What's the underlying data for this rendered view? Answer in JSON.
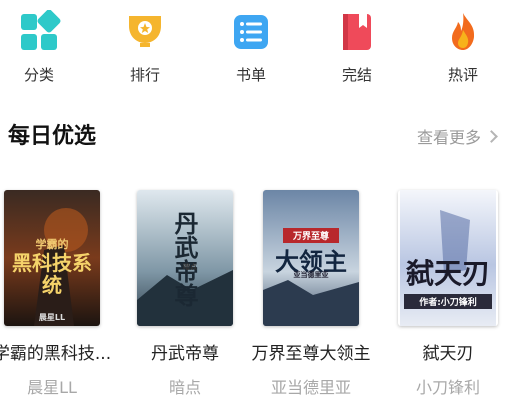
{
  "nav": [
    {
      "label": "分类",
      "icon": "grid-icon",
      "color": "#2ec9c9"
    },
    {
      "label": "排行",
      "icon": "trophy-icon",
      "color": "#f5b52e"
    },
    {
      "label": "书单",
      "icon": "list-icon",
      "color": "#3ea6f2"
    },
    {
      "label": "完结",
      "icon": "book-icon",
      "color": "#ef4a5a"
    },
    {
      "label": "热评",
      "icon": "flame-icon",
      "color": "#f26b1d"
    }
  ],
  "section": {
    "title": "每日优选",
    "more_label": "查看更多"
  },
  "books": [
    {
      "title": "学霸的黑科技...",
      "author": "晨星LL",
      "cover_text": "黑科技系统",
      "cover_top_text": "学霸的",
      "cover_footer": "晨星LL"
    },
    {
      "title": "丹武帝尊",
      "author": "暗点",
      "cover_text": "丹武帝尊",
      "cover_footer": "暗点"
    },
    {
      "title": "万界至尊大领主",
      "author": "亚当德里亚",
      "cover_text": "大领主",
      "cover_top_text": "万界至尊",
      "cover_footer": "亚当德里亚"
    },
    {
      "title": "弑天刃",
      "author": "小刀锋利",
      "cover_text": "弑天刃",
      "cover_footer": "作者:小刀锋利"
    }
  ]
}
